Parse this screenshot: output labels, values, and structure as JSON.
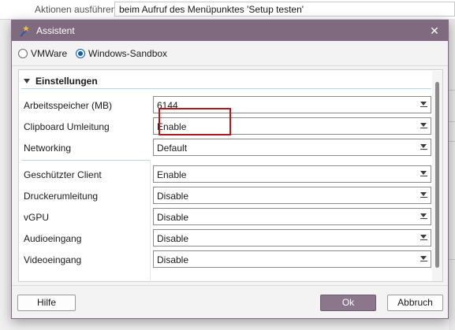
{
  "background": {
    "actions_label": "Aktionen ausführen:",
    "actions_value": "beim Aufruf des Menüpunktes 'Setup testen'"
  },
  "dialog": {
    "title": "Assistent",
    "close_glyph": "✕",
    "title_icon": "wizard-icon",
    "accent_color": "#7f6a80"
  },
  "radios": [
    {
      "label": "VMWare",
      "checked": false
    },
    {
      "label": "Windows-Sandbox",
      "checked": true
    }
  ],
  "section": {
    "title": "Einstellungen"
  },
  "settings": [
    {
      "label": "Arbeitsspeicher (MB)",
      "value": "6144"
    },
    {
      "label": "Clipboard Umleitung",
      "value": "Enable"
    },
    {
      "label": "Networking",
      "value": "Default"
    },
    {
      "label": "Geschützter Client",
      "value": "Enable"
    },
    {
      "label": "Druckerumleitung",
      "value": "Disable"
    },
    {
      "label": "vGPU",
      "value": "Disable"
    },
    {
      "label": "Audioeingang",
      "value": "Disable"
    },
    {
      "label": "Videoeingang",
      "value": "Disable"
    }
  ],
  "buttons": {
    "help": "Hilfe",
    "ok": "Ok",
    "cancel": "Abbruch"
  }
}
